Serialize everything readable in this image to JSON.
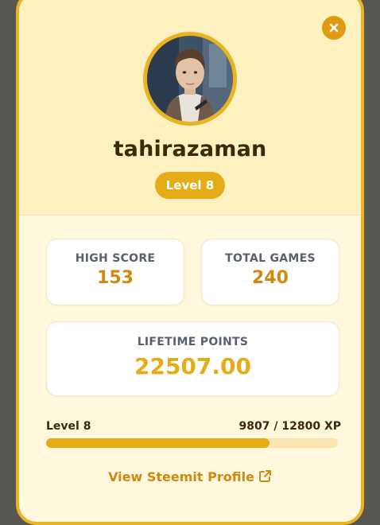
{
  "profile": {
    "username": "tahirazaman",
    "level_badge": "Level 8"
  },
  "stats": {
    "high_score_label": "HIGH SCORE",
    "high_score_value": "153",
    "total_games_label": "TOTAL GAMES",
    "total_games_value": "240",
    "lifetime_points_label": "LIFETIME POINTS",
    "lifetime_points_value": "22507.00"
  },
  "progress": {
    "level_label": "Level 8",
    "xp_text": "9807 / 12800 XP",
    "current_xp": 9807,
    "max_xp": 12800
  },
  "link": {
    "label": "View Steemit Profile"
  },
  "icons": {
    "close": "close-icon",
    "external": "external-link-icon"
  },
  "colors": {
    "accent": "#e6ac17",
    "accent_dark": "#d08a0f",
    "border": "#e9b321",
    "panel_bg": "#fff8df",
    "header_bg": "#fdf1bf",
    "text_dark": "#3a2a07"
  }
}
